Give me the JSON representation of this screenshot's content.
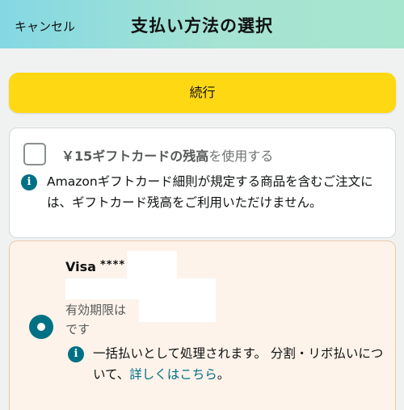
{
  "header": {
    "cancel_label": "キャンセル",
    "title": "支払い方法の選択"
  },
  "continue_button": {
    "label": "続行"
  },
  "gift_card": {
    "checked": false,
    "label_bold": "￥15ギフトカードの残高",
    "label_rest": "を使用する",
    "info_text": "Amazonギフトカード細則が規定する商品を含むご注文には、ギフトカード残高をご利用いただけません。"
  },
  "visa": {
    "selected": true,
    "brand": "Visa",
    "masked_number": "****",
    "expiry_label": "有効期限は",
    "expiry_suffix": "です",
    "info_text": "一括払いとして処理されます。 分割・リボ払いについて、",
    "details_link": "詳しくはこちら",
    "info_end": "。"
  },
  "colors": {
    "header_gradient_start": "#84d8e3",
    "header_gradient_end": "#a6e6cf",
    "continue_button": "#ffd814",
    "accent_teal": "#007185",
    "selected_card_bg": "#fdf3ea",
    "selected_card_border": "#f0c8a6"
  }
}
